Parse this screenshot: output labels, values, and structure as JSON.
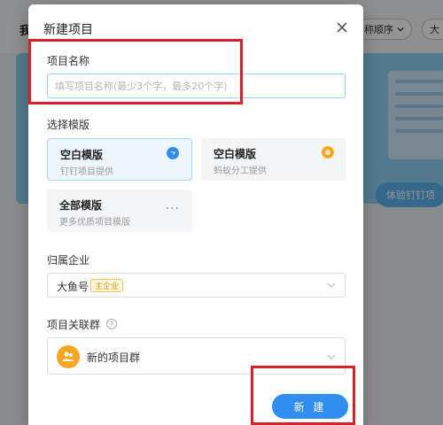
{
  "background": {
    "my_label": "我",
    "sort_label": "称顺序",
    "big_label": "大",
    "cta_label": "体验钉钉项"
  },
  "modal": {
    "title": "新建项目",
    "project_name": {
      "label": "项目名称",
      "placeholder": "填写项目名称(最少3个字，最多20个字)"
    },
    "template": {
      "label": "选择模版",
      "options": [
        {
          "title": "空白模版",
          "subtitle": "钉钉项目提供",
          "icon": "dingtalk-icon",
          "selected": true
        },
        {
          "title": "空白模版",
          "subtitle": "蚂蚁分工提供",
          "icon": "antwork-icon",
          "selected": false
        },
        {
          "title": "全部模版",
          "subtitle": "更多优质项目模版",
          "icon": "more-icon",
          "selected": false
        }
      ]
    },
    "enterprise": {
      "label": "归属企业",
      "value": "大鱼号",
      "badge": "主企业"
    },
    "group": {
      "label": "项目关联群",
      "value": "新的项目群"
    },
    "create_label": "新 建"
  },
  "colors": {
    "primary": "#2f8ef0",
    "annotation_red": "#d8202a",
    "badge_orange": "#f5a623"
  }
}
